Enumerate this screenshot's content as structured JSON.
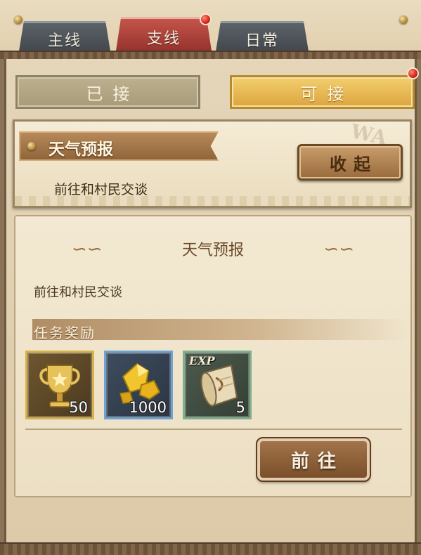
{
  "tabs": [
    {
      "label": "主线",
      "state": "inactive"
    },
    {
      "label": "支线",
      "state": "active",
      "has_notification": true
    },
    {
      "label": "日常",
      "state": "inactive"
    }
  ],
  "filters": {
    "accepted_label": "已接",
    "available_label": "可接",
    "available_has_notification": true
  },
  "quest_card": {
    "title": "天气预报",
    "description": "前往和村民交谈",
    "collapse_label": "收起",
    "watermark": "WA"
  },
  "detail": {
    "title": "天气预报",
    "description": "前往和村民交谈",
    "rewards_heading": "任务奖励",
    "rewards": [
      {
        "type": "trophy",
        "icon": "trophy-icon",
        "count": "50",
        "frame_color": "#d7b24a"
      },
      {
        "type": "gold-ore",
        "icon": "gold-nugget-icon",
        "count": "1000",
        "frame_color": "#6fa3d6"
      },
      {
        "type": "exp-scroll",
        "icon": "exp-scroll-icon",
        "label": "EXP",
        "count": "5",
        "frame_color": "#7fb08d"
      }
    ],
    "go_label": "前往"
  },
  "colors": {
    "active_tab": "#b2443c",
    "inactive_tab": "#4d545a",
    "available_filter": "#e6b44f",
    "accepted_filter": "#b3a684",
    "notification_dot": "#d6221a"
  }
}
